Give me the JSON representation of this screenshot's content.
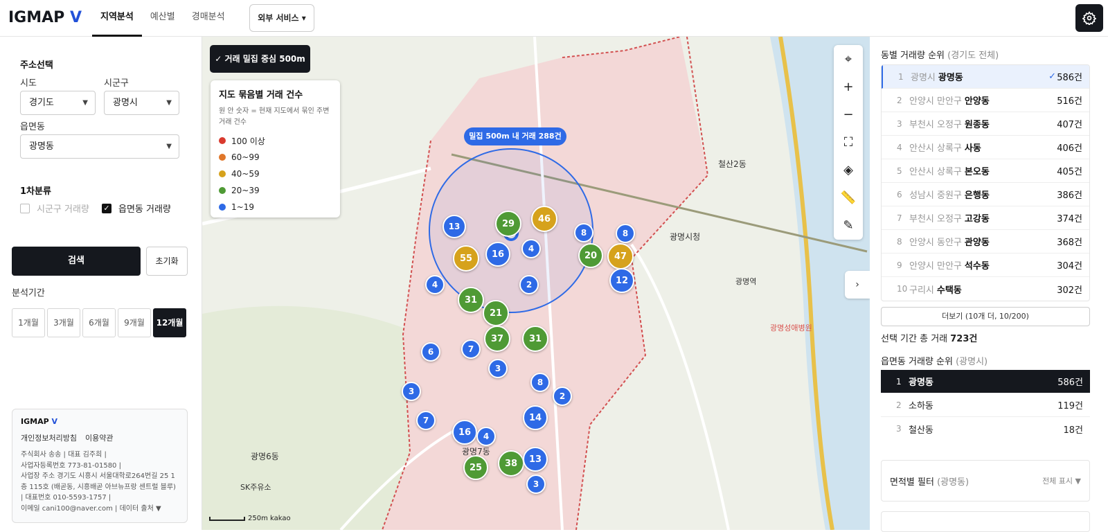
{
  "header": {
    "logo_main": "IGMAP",
    "logo_v": "V",
    "tabs": [
      "지역분석",
      "예산별",
      "경매분석"
    ],
    "ext_service": "외부 서비스",
    "settings_icon": "gear-icon"
  },
  "sidebar": {
    "address_title": "주소선택",
    "sido_label": "시도",
    "sido_value": "경기도",
    "sigungu_label": "시군구",
    "sigungu_value": "광명시",
    "eup_label": "읍면동",
    "eup_value": "광명동",
    "category_title": "1차분류",
    "chk_sigungu": "시군구 거래량",
    "chk_eup": "읍면동 거래량",
    "search_btn": "검색",
    "reset_btn": "초기화",
    "period_title": "분석기간",
    "periods": [
      "1개월",
      "3개월",
      "6개월",
      "9개월",
      "12개월"
    ],
    "active_period": "12개월"
  },
  "footer": {
    "brand": "IGMAP",
    "brand_v": "V",
    "privacy": "개인정보처리방침",
    "terms": "이용약관",
    "line1": "주식회사 송송 | 대표 김주희 |",
    "line2": "사업자등록번호 773-81-01580 |",
    "line3": "사업장 주소 경기도 시흥시 서울대학로264번길 25 1층 115호 (배곧동, 시흥배곧 아브뉴프랑 센트럴 블루)",
    "line4": "| 대표번호 010-5593-1757 |",
    "line5": "이메일 cani100@naver.com | 데이터 출처 ▼"
  },
  "map": {
    "dense_badge": "✓ 거래 밀집 중심 500m",
    "legend_title": "지도 묶음별 거래 건수",
    "legend_desc": "원 안 숫자 = 현재 지도에서 묶인 주변 거래 건수",
    "legend_items": [
      {
        "label": "100 이상",
        "color": "#d93a2e"
      },
      {
        "label": "60~99",
        "color": "#e0772a"
      },
      {
        "label": "40~59",
        "color": "#d6a21c"
      },
      {
        "label": "20~39",
        "color": "#4f9a35"
      },
      {
        "label": "1~19",
        "color": "#2e6ae6"
      }
    ],
    "dense_label": "밀집 500m 내 거래 288건",
    "scale_text": "250m",
    "provider": "kakao",
    "collapse_arrow": "›",
    "place_labels": [
      "광명7동",
      "광명6동",
      "광명시청",
      "철산2동",
      "광명역",
      "광명성애병원",
      "SK주유소"
    ],
    "clusters": [
      {
        "v": 13
      },
      {
        "v": 29
      },
      {
        "v": 46
      },
      {
        "v": 8
      },
      {
        "v": 8
      },
      {
        "v": 55
      },
      {
        "v": 16
      },
      {
        "v": 4
      },
      {
        "v": 20
      },
      {
        "v": 47
      },
      {
        "v": 4
      },
      {
        "v": 2
      },
      {
        "v": 12
      },
      {
        "v": 31
      },
      {
        "v": 21
      },
      {
        "v": 37
      },
      {
        "v": 31
      },
      {
        "v": 6
      },
      {
        "v": 7
      },
      {
        "v": 3
      },
      {
        "v": 8
      },
      {
        "v": 2
      },
      {
        "v": 3
      },
      {
        "v": 7
      },
      {
        "v": 16
      },
      {
        "v": 4
      },
      {
        "v": 14
      },
      {
        "v": 25
      },
      {
        "v": 38
      },
      {
        "v": 13
      },
      {
        "v": 3
      }
    ]
  },
  "right": {
    "rank_title": "동별 거래량 순위",
    "rank_sub": "(경기도 전체)",
    "ranks": [
      {
        "n": "1",
        "region": "광명시",
        "name": "광명동",
        "cnt": "586건"
      },
      {
        "n": "2",
        "region": "안양시 만안구",
        "name": "안양동",
        "cnt": "516건"
      },
      {
        "n": "3",
        "region": "부천시 오정구",
        "name": "원종동",
        "cnt": "407건"
      },
      {
        "n": "4",
        "region": "안산시 상록구",
        "name": "사동",
        "cnt": "406건"
      },
      {
        "n": "5",
        "region": "안산시 상록구",
        "name": "본오동",
        "cnt": "405건"
      },
      {
        "n": "6",
        "region": "성남시 중원구",
        "name": "은행동",
        "cnt": "386건"
      },
      {
        "n": "7",
        "region": "부천시 오정구",
        "name": "고강동",
        "cnt": "374건"
      },
      {
        "n": "8",
        "region": "안양시 동안구",
        "name": "관양동",
        "cnt": "368건"
      },
      {
        "n": "9",
        "region": "안양시 만안구",
        "name": "석수동",
        "cnt": "304건"
      },
      {
        "n": "10",
        "region": "구리시",
        "name": "수택동",
        "cnt": "302건"
      }
    ],
    "check_mark": "✓",
    "more_btn": "더보기 (10개 더, 10/200)",
    "total_label": "선택 기간 총 거래",
    "total_value": "723건",
    "rank2_title": "읍면동 거래량 순위",
    "rank2_sub": "(광명시)",
    "ranks2": [
      {
        "n": "1",
        "name": "광명동",
        "cnt": "586건"
      },
      {
        "n": "2",
        "name": "소하동",
        "cnt": "119건"
      },
      {
        "n": "3",
        "name": "철산동",
        "cnt": "18건"
      }
    ],
    "area_filter": "면적별 필터",
    "area_sub": "(광명동)",
    "area_opt": "전체 표시 ▼"
  }
}
